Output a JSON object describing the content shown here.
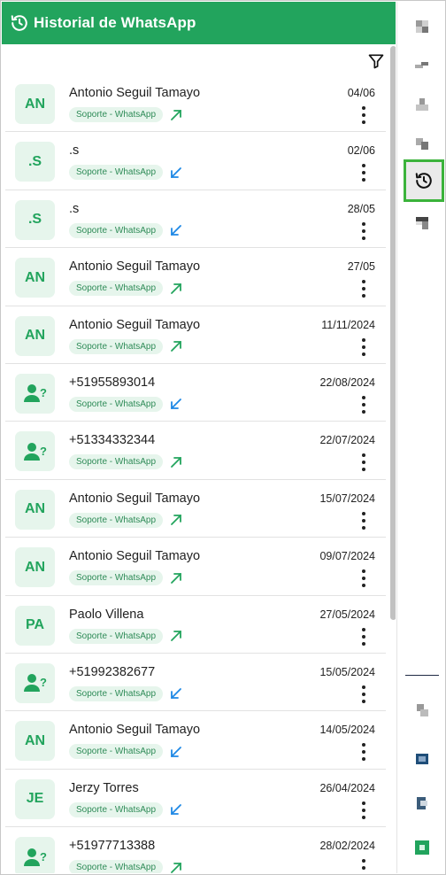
{
  "header": {
    "title": "Historial de WhatsApp"
  },
  "colors": {
    "brand": "#22a45d",
    "incoming": "#1e88e5",
    "outgoing": "#22a45d",
    "active_border": "#3bb33b"
  },
  "icons": {
    "header": "history-icon",
    "filter": "filter-icon",
    "sidebar_active": "history-icon"
  },
  "conversations": [
    {
      "avatar": "AN",
      "name": "Antonio Seguil Tamayo",
      "tag": "Soporte - WhatsApp",
      "direction": "outgoing",
      "date": "04/06"
    },
    {
      "avatar": ".S",
      "name": ".s",
      "tag": "Soporte - WhatsApp",
      "direction": "incoming",
      "date": "02/06"
    },
    {
      "avatar": ".S",
      "name": ".s",
      "tag": "Soporte - WhatsApp",
      "direction": "incoming",
      "date": "28/05"
    },
    {
      "avatar": "AN",
      "name": "Antonio Seguil Tamayo",
      "tag": "Soporte - WhatsApp",
      "direction": "outgoing",
      "date": "27/05"
    },
    {
      "avatar": "AN",
      "name": "Antonio Seguil Tamayo",
      "tag": "Soporte - WhatsApp",
      "direction": "outgoing",
      "date": "11/11/2024"
    },
    {
      "avatar": "unknown-user-icon",
      "name": "+51955893014",
      "tag": "Soporte - WhatsApp",
      "direction": "incoming",
      "date": "22/08/2024"
    },
    {
      "avatar": "unknown-user-icon",
      "name": "+51334332344",
      "tag": "Soporte - WhatsApp",
      "direction": "outgoing",
      "date": "22/07/2024"
    },
    {
      "avatar": "AN",
      "name": "Antonio Seguil Tamayo",
      "tag": "Soporte - WhatsApp",
      "direction": "outgoing",
      "date": "15/07/2024"
    },
    {
      "avatar": "AN",
      "name": "Antonio Seguil Tamayo",
      "tag": "Soporte - WhatsApp",
      "direction": "outgoing",
      "date": "09/07/2024"
    },
    {
      "avatar": "PA",
      "name": "Paolo Villena",
      "tag": "Soporte - WhatsApp",
      "direction": "outgoing",
      "date": "27/05/2024"
    },
    {
      "avatar": "unknown-user-icon",
      "name": "+51992382677",
      "tag": "Soporte - WhatsApp",
      "direction": "incoming",
      "date": "15/05/2024"
    },
    {
      "avatar": "AN",
      "name": "Antonio Seguil Tamayo",
      "tag": "Soporte - WhatsApp",
      "direction": "incoming",
      "date": "14/05/2024"
    },
    {
      "avatar": "JE",
      "name": "Jerzy Torres",
      "tag": "Soporte - WhatsApp",
      "direction": "incoming",
      "date": "26/04/2024"
    },
    {
      "avatar": "unknown-user-icon",
      "name": "+51977713388",
      "tag": "Soporte - WhatsApp",
      "direction": "outgoing",
      "date": "28/02/2024"
    }
  ]
}
